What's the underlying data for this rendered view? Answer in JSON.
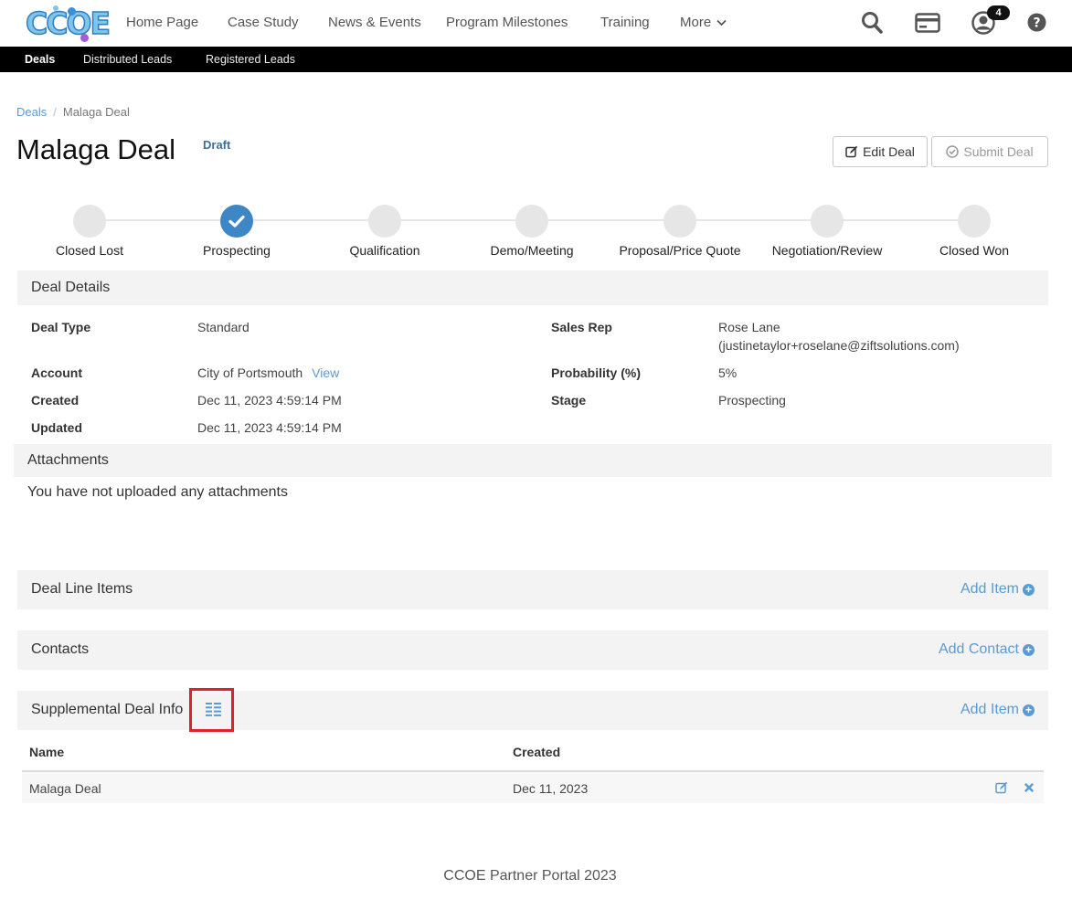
{
  "nav": {
    "logo_text": "CCOE",
    "links": [
      "Home Page",
      "Case Study",
      "News & Events",
      "Program Milestones",
      "Training",
      "More"
    ],
    "notification_count": "4",
    "icons": [
      "search-icon",
      "credit-card-icon",
      "user-icon",
      "help-icon"
    ]
  },
  "subnav": {
    "items": [
      "Deals",
      "Distributed Leads",
      "Registered Leads"
    ]
  },
  "breadcrumb": {
    "root": "Deals",
    "current": "Malaga Deal"
  },
  "page": {
    "title": "Malaga Deal",
    "status": "Draft",
    "edit_label": "Edit Deal",
    "submit_label": "Submit Deal"
  },
  "stages": [
    {
      "label": "Closed Lost",
      "done": false
    },
    {
      "label": "Prospecting",
      "done": true
    },
    {
      "label": "Qualification",
      "done": false
    },
    {
      "label": "Demo/Meeting",
      "done": false
    },
    {
      "label": "Proposal/Price Quote",
      "done": false
    },
    {
      "label": "Negotiation/Review",
      "done": false
    },
    {
      "label": "Closed Won",
      "done": false
    }
  ],
  "deal_details": {
    "title": "Deal Details",
    "deal_type_label": "Deal Type",
    "deal_type": "Standard",
    "account_label": "Account",
    "account": "City of Portsmouth",
    "account_view": "View",
    "created_label": "Created",
    "created": "Dec 11, 2023 4:59:14 PM",
    "updated_label": "Updated",
    "updated": "Dec 11, 2023 4:59:14 PM",
    "sales_rep_label": "Sales Rep",
    "sales_rep_name": "Rose Lane",
    "sales_rep_email": "(justinetaylor+roselane@ziftsolutions.com)",
    "probability_label": "Probability (%)",
    "probability": "5%",
    "stage_label": "Stage",
    "stage": "Prospecting"
  },
  "attachments": {
    "title": "Attachments",
    "empty_text": "You have not uploaded any attachments"
  },
  "line_items": {
    "title": "Deal Line Items",
    "action": "Add Item"
  },
  "contacts": {
    "title": "Contacts",
    "action": "Add Contact"
  },
  "supplemental": {
    "title": "Supplemental Deal Info",
    "action": "Add Item",
    "columns": [
      "Name",
      "Created"
    ],
    "rows": [
      {
        "name": "Malaga Deal",
        "created": "Dec 11, 2023"
      }
    ]
  },
  "footer": "CCOE Partner Portal 2023",
  "colors": {
    "accent": "#5b9bd5",
    "stage_done": "#3e86c5",
    "highlight": "#e0202a"
  }
}
